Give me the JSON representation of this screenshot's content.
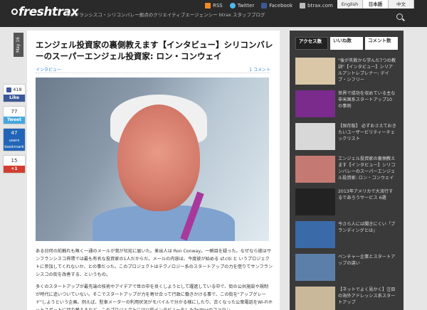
{
  "header": {
    "logo": "freshtrax",
    "tagline": "サンフランシスコ・シリコンバレー拠点のクリエイティブエージェンシー btrax スタッフブログ",
    "links": [
      {
        "label": "RSS",
        "icon": "rss-icon"
      },
      {
        "label": "Twitter",
        "icon": "twitter-icon"
      },
      {
        "label": "Facebook",
        "icon": "facebook-icon"
      },
      {
        "label": "btrax.com",
        "icon": "mail-icon"
      }
    ],
    "languages": [
      "English",
      "日本語",
      "中文"
    ],
    "active_language": "日本語"
  },
  "date_badge": "May 16",
  "share": {
    "like_count": "418",
    "like_label": "Like",
    "tweet_count": "77",
    "tweet_label": "Tweet",
    "hatena_count": "47",
    "hatena_label": "users",
    "hatena_sub": "bookmark",
    "gplus_count": "15",
    "gplus_label": "+1"
  },
  "article": {
    "title": "エンジェル投資家の裏側教えます【インタビュー】シリコンバレーのスーパーエンジェル投資家: ロン・コンウェイ",
    "category": "インタビュー",
    "comments": "1 コメント",
    "paragraphs": [
      "ある日何の前触れも無く一通のメールが我が社宛に届いた。差出人は Ron Conway。一瞬目を疑った。なぜなら彼はサンフランシスコ界隈では最も有名な投資家の1人だからだ。メールの内容は、今度彼が始める sf.citi と いうプロジェクトに参加してくれないか、との事だった。このプロジェクトはテクノロジー系のスタートアップの力を借りてサンフランシスコの街を改善する、というもの。",
      "多くのスタートアップが最先端の技術やアイデアで世の中を良くしようとして躍進している中で、街の公共施設や規制が時代に追いついていない。そこでスタートアップが力を寄せ合って行政に働きかける事で、この街を\"アップグレード\"しようという企画。例えば、駐車メーターの利用状況がモバイルで分かる様にしたり、古くなった公衆電話をWi-Fiホットスポットに切り替えるなど。このプロジェクトには以前インタビューをしたTwitterのファウン"
    ]
  },
  "sidebar": {
    "tabs": [
      "アクセス数",
      "いいね数",
      "コメント数"
    ],
    "active_tab": "アクセス数",
    "items": [
      {
        "title": "\"後が失敗から学んだ7つの教訓\"【インタビュー】シリアルアントレプレナー: デイブ・シフリー",
        "thumb": "#d9c7a8"
      },
      {
        "title": "世界で成功を収めている主な非米国系スタートアップ10の事例",
        "thumb": "#7a2b8c"
      },
      {
        "title": "【保存版】 必ずおさえておきたいユーザービリティーチェックリスト",
        "thumb": "#d8d8d8"
      },
      {
        "title": "エンジェル投資家の裏側教えます【インタビュー】シリコンバレーのスーパーエンジェル投資家: ロン・コンウェイ",
        "thumb": "#c47a72"
      },
      {
        "title": "2013年アメリカで大流行するであろうサービス 6選",
        "thumb": "#222222"
      },
      {
        "title": "今さら人には聞きにくい「ブランディングとは」",
        "thumb": "#3a6aa8"
      },
      {
        "title": "ベンチャー企業とスタートアップの違い",
        "thumb": "#5b7fa8"
      },
      {
        "title": "【ネットでよく見かく】注目の海外アドレッシス系スタートアップ",
        "thumb": "#c9b89a"
      }
    ]
  }
}
